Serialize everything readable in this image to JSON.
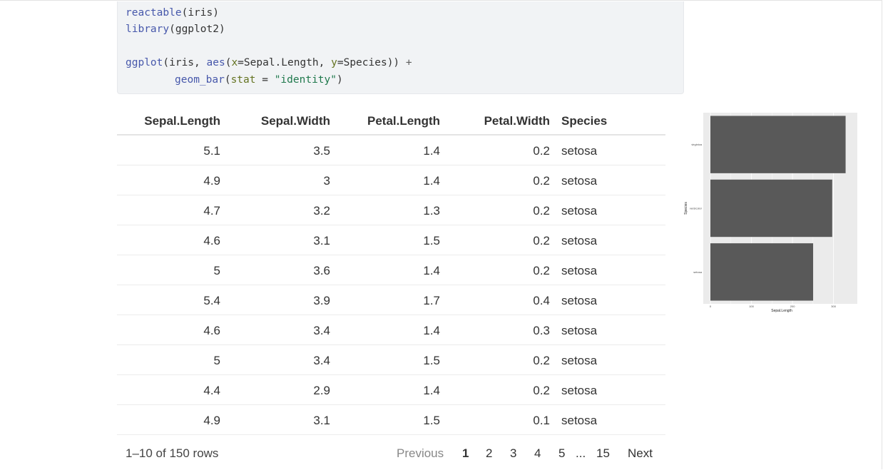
{
  "code": {
    "line1": {
      "fn": "reactable",
      "open": "(",
      "arg": "iris",
      "close": ")"
    },
    "line2": {
      "fn": "library",
      "open": "(",
      "arg": "ggplot2",
      "close": ")"
    },
    "line4": {
      "fn": "ggplot",
      "p1": "(iris, ",
      "fn2": "aes",
      "p2": "(",
      "a1": "x",
      "p3": "=Sepal.Length, ",
      "a2": "y",
      "p4": "=Species)) ",
      "op": "+"
    },
    "line5": {
      "fn": "geom_bar",
      "p1": "(",
      "a1": "stat",
      "p2": " = ",
      "str": "\"identity\"",
      "p3": ")"
    }
  },
  "table": {
    "columns": [
      "Sepal.Length",
      "Sepal.Width",
      "Petal.Length",
      "Petal.Width",
      "Species"
    ],
    "rows": [
      [
        "5.1",
        "3.5",
        "1.4",
        "0.2",
        "setosa"
      ],
      [
        "4.9",
        "3",
        "1.4",
        "0.2",
        "setosa"
      ],
      [
        "4.7",
        "3.2",
        "1.3",
        "0.2",
        "setosa"
      ],
      [
        "4.6",
        "3.1",
        "1.5",
        "0.2",
        "setosa"
      ],
      [
        "5",
        "3.6",
        "1.4",
        "0.2",
        "setosa"
      ],
      [
        "5.4",
        "3.9",
        "1.7",
        "0.4",
        "setosa"
      ],
      [
        "4.6",
        "3.4",
        "1.4",
        "0.3",
        "setosa"
      ],
      [
        "5",
        "3.4",
        "1.5",
        "0.2",
        "setosa"
      ],
      [
        "4.4",
        "2.9",
        "1.4",
        "0.2",
        "setosa"
      ],
      [
        "4.9",
        "3.1",
        "1.5",
        "0.1",
        "setosa"
      ]
    ]
  },
  "pagination": {
    "info": "1–10 of 150 rows",
    "previous": "Previous",
    "pages": [
      "1",
      "2",
      "3",
      "4",
      "5",
      "...",
      "15"
    ],
    "current": "1",
    "next": "Next"
  },
  "chart_data": {
    "type": "bar",
    "orientation": "horizontal",
    "categories": [
      "setosa",
      "versicolor",
      "virginica"
    ],
    "values": [
      250.3,
      296.8,
      329.4
    ],
    "xlabel": "Sepal.Length",
    "ylabel": "Species",
    "xticks": [
      "0",
      "100",
      "200",
      "300"
    ],
    "xlim": [
      0,
      345
    ],
    "grid": true,
    "colors": {
      "bar": "#595959",
      "panel": "#ebebeb",
      "gridline": "#ffffff"
    }
  }
}
